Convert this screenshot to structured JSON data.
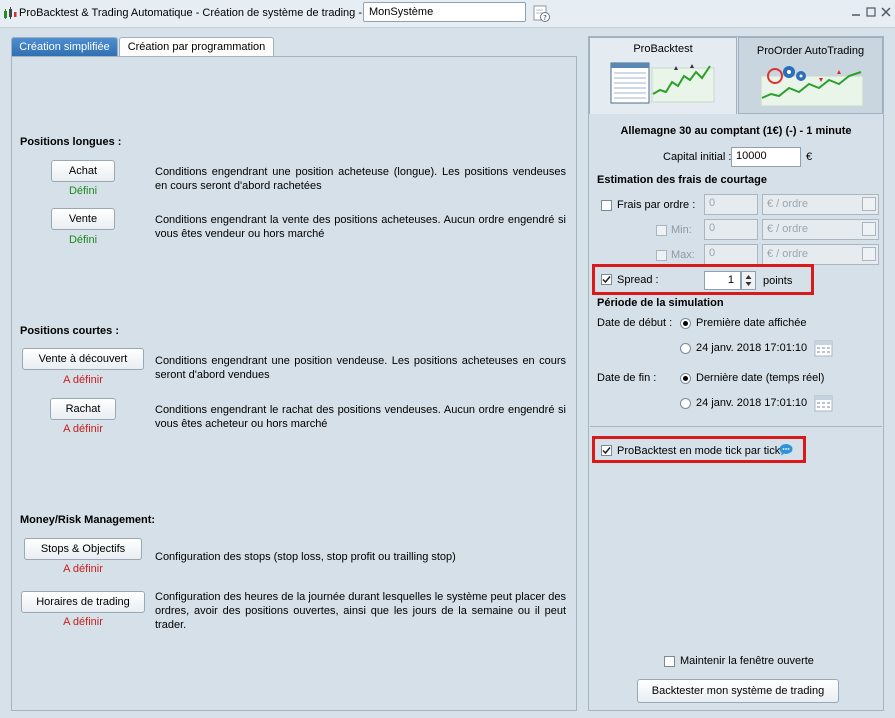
{
  "window": {
    "title": "ProBacktest & Trading Automatique - Création de système de trading  -",
    "system_name": "MonSystème",
    "help_icon": "help-icon",
    "controls": [
      "minimize",
      "maximize",
      "close"
    ]
  },
  "left": {
    "tabs": [
      "Création simplifiée",
      "Création par programmation"
    ],
    "active_tab": 0,
    "long": {
      "title": "Positions longues :",
      "buy_label": "Achat",
      "buy_status": "Défini",
      "buy_desc": "Conditions engendrant une position acheteuse (longue). Les positions vendeuses en cours seront d'abord rachetées",
      "sell_label": "Vente",
      "sell_status": "Défini",
      "sell_desc": "Conditions engendrant la vente des positions acheteuses. Aucun ordre engendré si vous êtes vendeur ou hors marché"
    },
    "short": {
      "title": "Positions courtes :",
      "short_label": "Vente à découvert",
      "short_status": "A définir",
      "short_desc": "Conditions engendrant une position vendeuse. Les positions acheteuses en cours seront d'abord vendues",
      "cover_label": "Rachat",
      "cover_status": "A définir",
      "cover_desc": "Conditions engendrant le rachat des positions vendeuses. Aucun ordre engendré si vous êtes acheteur ou hors marché"
    },
    "money": {
      "title": "Money/Risk Management:",
      "stops_label": "Stops & Objectifs",
      "stops_status": "A définir",
      "stops_desc": "Configuration des stops (stop loss, stop profit ou trailling stop)",
      "hours_label": "Horaires de trading",
      "hours_status": "A définir",
      "hours_desc": "Configuration des heures de la journée durant lesquelles le système peut placer des ordres, avoir des positions ouvertes, ainsi que les jours de la semaine ou il peut trader."
    }
  },
  "right": {
    "tabs": [
      "ProBacktest",
      "ProOrder AutoTrading"
    ],
    "active_tab": 0,
    "instrument": "Allemagne 30 au comptant (1€) (-) - 1 minute",
    "capital_label": "Capital initial :",
    "capital_value": "10000",
    "currency": "€",
    "fees": {
      "title": "Estimation des frais de courtage",
      "per_order_label": "Frais par ordre :",
      "per_order_value": "0",
      "per_order_unit": "€ / ordre",
      "min_label": "Min:",
      "min_value": "0",
      "min_unit": "€ / ordre",
      "max_label": "Max:",
      "max_value": "0",
      "max_unit": "€ / ordre",
      "spread_label": "Spread :",
      "spread_value": "1",
      "spread_checked": true,
      "spread_unit": "points"
    },
    "period": {
      "title": "Période de la simulation",
      "start_label": "Date de début :",
      "start_opt1": "Première date affichée",
      "start_opt2": "24 janv. 2018 17:01:10",
      "start_selected": 0,
      "end_label": "Date de fin :",
      "end_opt1": "Dernière date (temps réel)",
      "end_opt2": "24 janv. 2018 17:01:10",
      "end_selected": 0
    },
    "tick_mode_label": "ProBacktest en mode tick par tick",
    "tick_mode_checked": true,
    "keep_open_label": "Maintenir la fenêtre ouverte",
    "keep_open_checked": false,
    "run_button": "Backtester mon système de trading"
  },
  "colors": {
    "active_tab": "#3b7cc2",
    "defined": "#1e8a1e",
    "undefined": "#c8201d",
    "highlight": "#d81a1a"
  }
}
